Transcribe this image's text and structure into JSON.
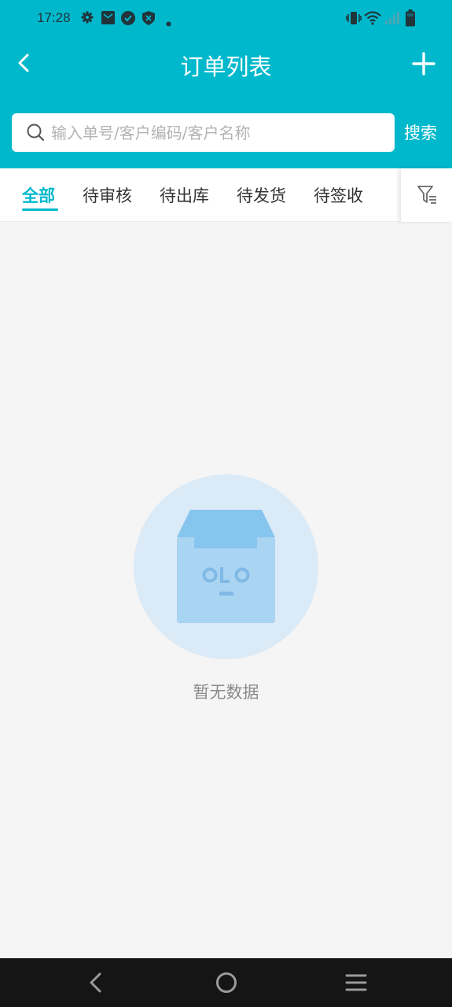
{
  "status_bar": {
    "time": "17:28",
    "icons": [
      "settings-icon",
      "mail-icon",
      "check-shield-icon",
      "shield-x-icon",
      "dot-icon",
      "vibrate-icon",
      "wifi-icon",
      "signal-icon",
      "battery-icon"
    ]
  },
  "header": {
    "title": "订单列表",
    "back_icon": "chevron-left-icon",
    "add_icon": "plus-icon"
  },
  "search": {
    "placeholder": "输入单号/客户编码/客户名称",
    "value": "",
    "button_label": "搜索"
  },
  "tabs": [
    {
      "label": "全部",
      "active": true
    },
    {
      "label": "待审核",
      "active": false
    },
    {
      "label": "待出库",
      "active": false
    },
    {
      "label": "待发货",
      "active": false
    },
    {
      "label": "待签收",
      "active": false
    }
  ],
  "filter_icon": "filter-list-icon",
  "empty_state": {
    "icon": "empty-box-icon",
    "text": "暂无数据"
  },
  "bottom_nav": [
    "back-icon",
    "home-icon",
    "menu-icon"
  ],
  "colors": {
    "accent": "#00b8cc",
    "background": "#f5f5f5",
    "empty_circle": "#dbeaf7",
    "box": "#a9d4f2",
    "box_dark": "#86c5ee"
  }
}
